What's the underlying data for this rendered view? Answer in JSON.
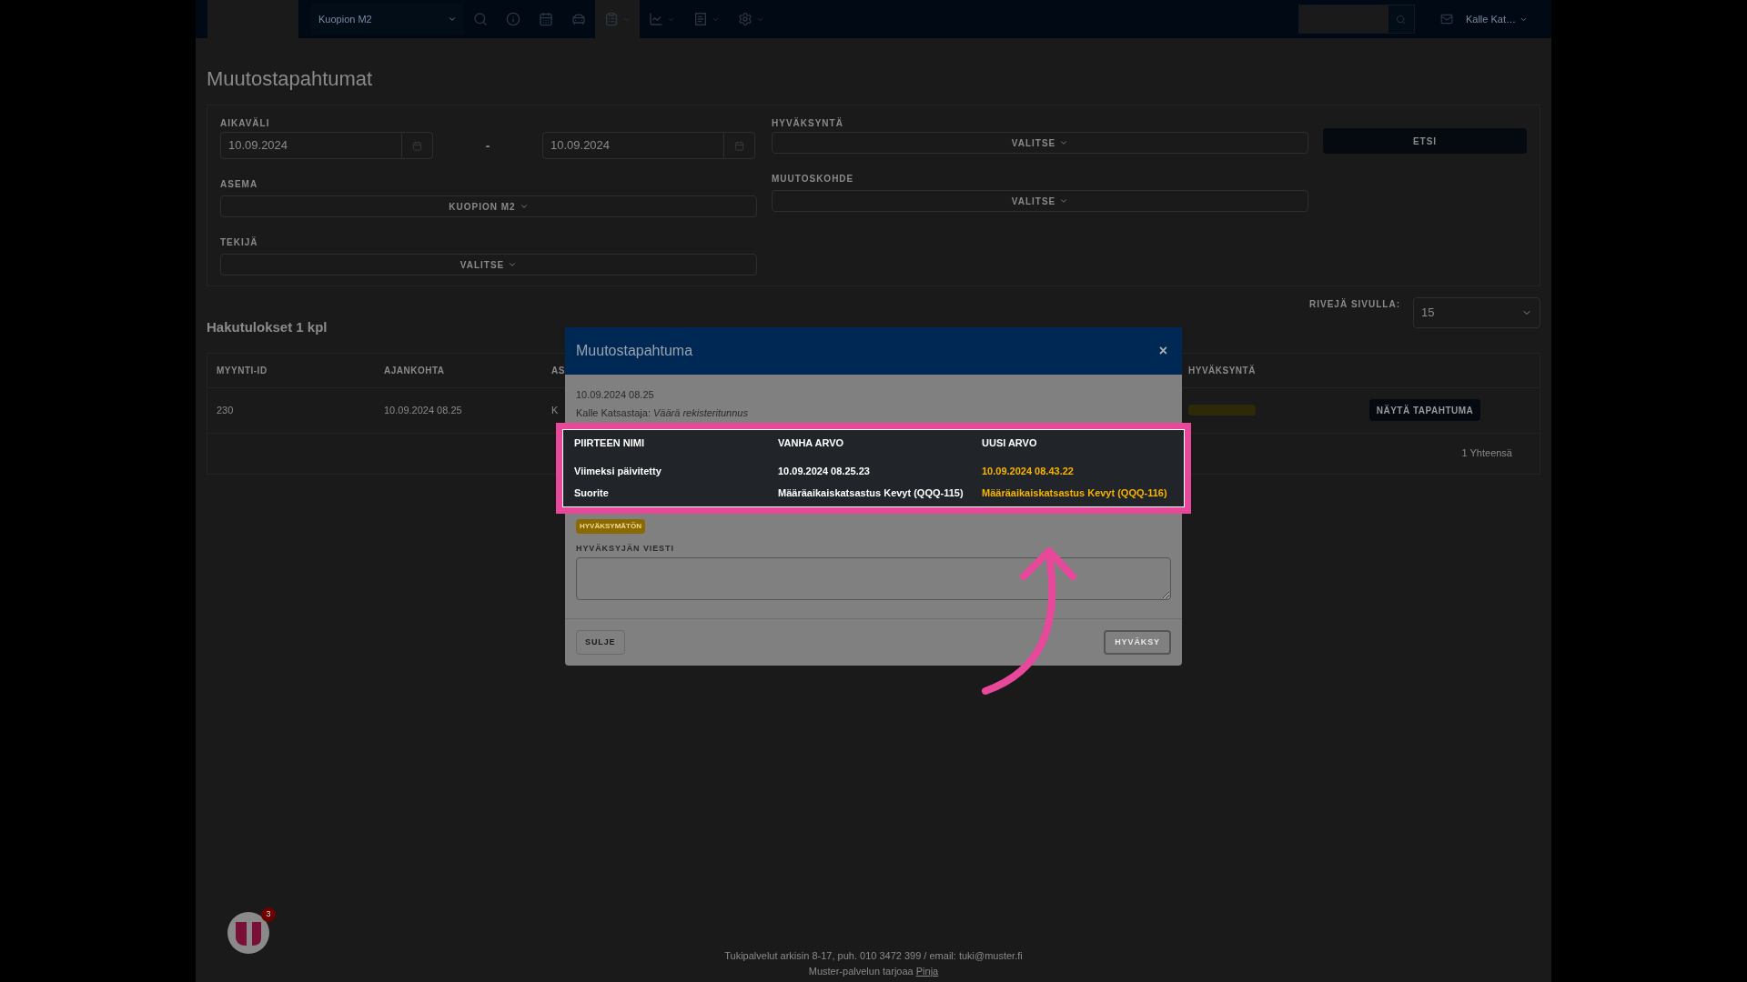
{
  "navbar": {
    "station": "Kuopion M2",
    "user": "Kalle Kat…",
    "items": [
      {
        "selected": false,
        "dropdown": false
      },
      {
        "selected": false,
        "dropdown": false
      },
      {
        "selected": false,
        "dropdown": false
      },
      {
        "selected": false,
        "dropdown": false
      },
      {
        "selected": true,
        "dropdown": true
      },
      {
        "selected": false,
        "dropdown": true
      },
      {
        "selected": false,
        "dropdown": true
      },
      {
        "selected": false,
        "dropdown": true
      }
    ]
  },
  "page_title": "Muutostapahtumat",
  "filters": {
    "period_label": "AIKAVÄLI",
    "date_from": "10.09.2024",
    "separator": "-",
    "date_to": "10.09.2024",
    "station_label": "ASEMA",
    "station_value": "KUOPION M2",
    "author_label": "TEKIJÄ",
    "author_value": "VALITSE",
    "approval_label": "HYVÄKSYNTÄ",
    "approval_value": "VALITSE",
    "target_label": "MUUTOSKOHDE",
    "target_value": "VALITSE",
    "search_button": "ETSI"
  },
  "results": {
    "heading": "Hakutulokset 1 kpl",
    "rows_per_page_label": "RIVEJÄ SIVULLA:",
    "rows_per_page": "15",
    "columns": [
      "MYYNTI-ID",
      "AJANKOHTA",
      "AS",
      "HYVÄKSYNTÄ"
    ],
    "rows": [
      {
        "id": "230",
        "time": "10.09.2024 08.25",
        "column_3": "K",
        "action": "NÄYTÄ TAPAHTUMA"
      }
    ],
    "total": "1 Yhteensä"
  },
  "modal": {
    "title": "Muutostapahtuma",
    "close": "×",
    "timestamp": "10.09.2024 08.25",
    "author": "Kalle Katsastaja:",
    "reason": "Väärä rekisteritunnus",
    "columns": [
      "PIIRTEEN NIMI",
      "VANHA ARVO",
      "UUSI ARVO"
    ],
    "rows": [
      {
        "name": "Viimeksi päivitetty",
        "old": "10.09.2024 08.25.23",
        "new": "10.09.2024 08.43.22"
      },
      {
        "name": "Suorite",
        "old": "Määräaikaiskatsastus Kevyt (QQQ-115)",
        "new": "Määräaikaiskatsastus Kevyt (QQQ-116)"
      }
    ],
    "status": "HYVÄKSYMÄTÖN",
    "message_label": "HYVÄKSYJÄN VIESTI",
    "close_button": "SULJE",
    "approve_button": "HYVÄKSY",
    "approve_disabled": true
  },
  "footer": {
    "notifications": "3",
    "support": "Tukipalvelut arkisin 8-17, puh. 010 3472 399 / email: tuki@muster.fi",
    "provider": "Muster-palvelun tarjoaa",
    "provider_link": "Pinja"
  }
}
